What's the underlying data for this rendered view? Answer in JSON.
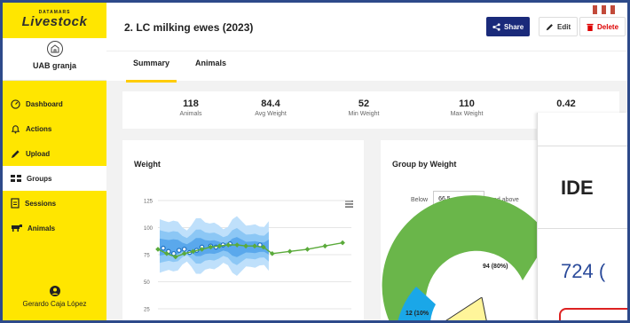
{
  "brand": {
    "small": "DATAMARS",
    "name": "Livestock"
  },
  "farm": {
    "name": "UAB granja",
    "icon": "farm-icon"
  },
  "nav": [
    {
      "label": "Dashboard",
      "icon": "dashboard-icon"
    },
    {
      "label": "Actions",
      "icon": "bell-icon"
    },
    {
      "label": "Upload",
      "icon": "pencil-icon"
    },
    {
      "label": "Groups",
      "icon": "groups-icon",
      "active": true
    },
    {
      "label": "Sessions",
      "icon": "document-icon"
    },
    {
      "label": "Animals",
      "icon": "sheep-icon"
    }
  ],
  "user": {
    "name": "Gerardo Caja López",
    "icon": "user-icon"
  },
  "header": {
    "title": "2. LC milking ewes (2023)",
    "share": "Share",
    "edit": "Edit",
    "delete": "Delete"
  },
  "tabs": [
    {
      "label": "Summary",
      "active": true
    },
    {
      "label": "Animals"
    }
  ],
  "stats": [
    {
      "value": "118",
      "label": "Animals"
    },
    {
      "value": "84.4",
      "label": "Avg Weight"
    },
    {
      "value": "52",
      "label": "Min Weight"
    },
    {
      "value": "110",
      "label": "Max Weight"
    },
    {
      "value": "0.42",
      "label": ""
    }
  ],
  "weight_card": {
    "title": "Weight"
  },
  "group_card": {
    "title": "Group by Weight",
    "below_label": "Below",
    "below_value": "66,5",
    "above_label": "and above",
    "slice_large": "94 (80%)",
    "slice_small": "12 (10%"
  },
  "overlay": {
    "ide": "IDE",
    "number": "724 ("
  },
  "colors": {
    "sidebar": "#ffe600",
    "share": "#1a2a7a",
    "delete": "#d00000",
    "accent": "#ffcc00",
    "green_series": "#5aaa3a",
    "blue_band": "#2b8fe0",
    "donut_green": "#6ab64a",
    "donut_blue": "#1aa7e8"
  },
  "chart_data": {
    "type": "line",
    "title": "Weight",
    "ylim": [
      25,
      125
    ],
    "yticks": [
      25,
      50,
      75,
      100,
      125
    ],
    "series": [
      {
        "points": [
          [
            0.0,
            80
          ],
          [
            0.5,
            76
          ],
          [
            1.0,
            73
          ],
          [
            1.5,
            76
          ],
          [
            2.0,
            78
          ],
          [
            2.5,
            80
          ],
          [
            3.0,
            82
          ],
          [
            3.5,
            83
          ],
          [
            4.0,
            84
          ],
          [
            4.5,
            84
          ],
          [
            5.0,
            83
          ],
          [
            5.5,
            83
          ],
          [
            6.0,
            82
          ],
          [
            6.5,
            76
          ],
          [
            7.5,
            78
          ],
          [
            8.5,
            80
          ],
          [
            9.5,
            83
          ],
          [
            10.5,
            86
          ]
        ]
      }
    ]
  }
}
